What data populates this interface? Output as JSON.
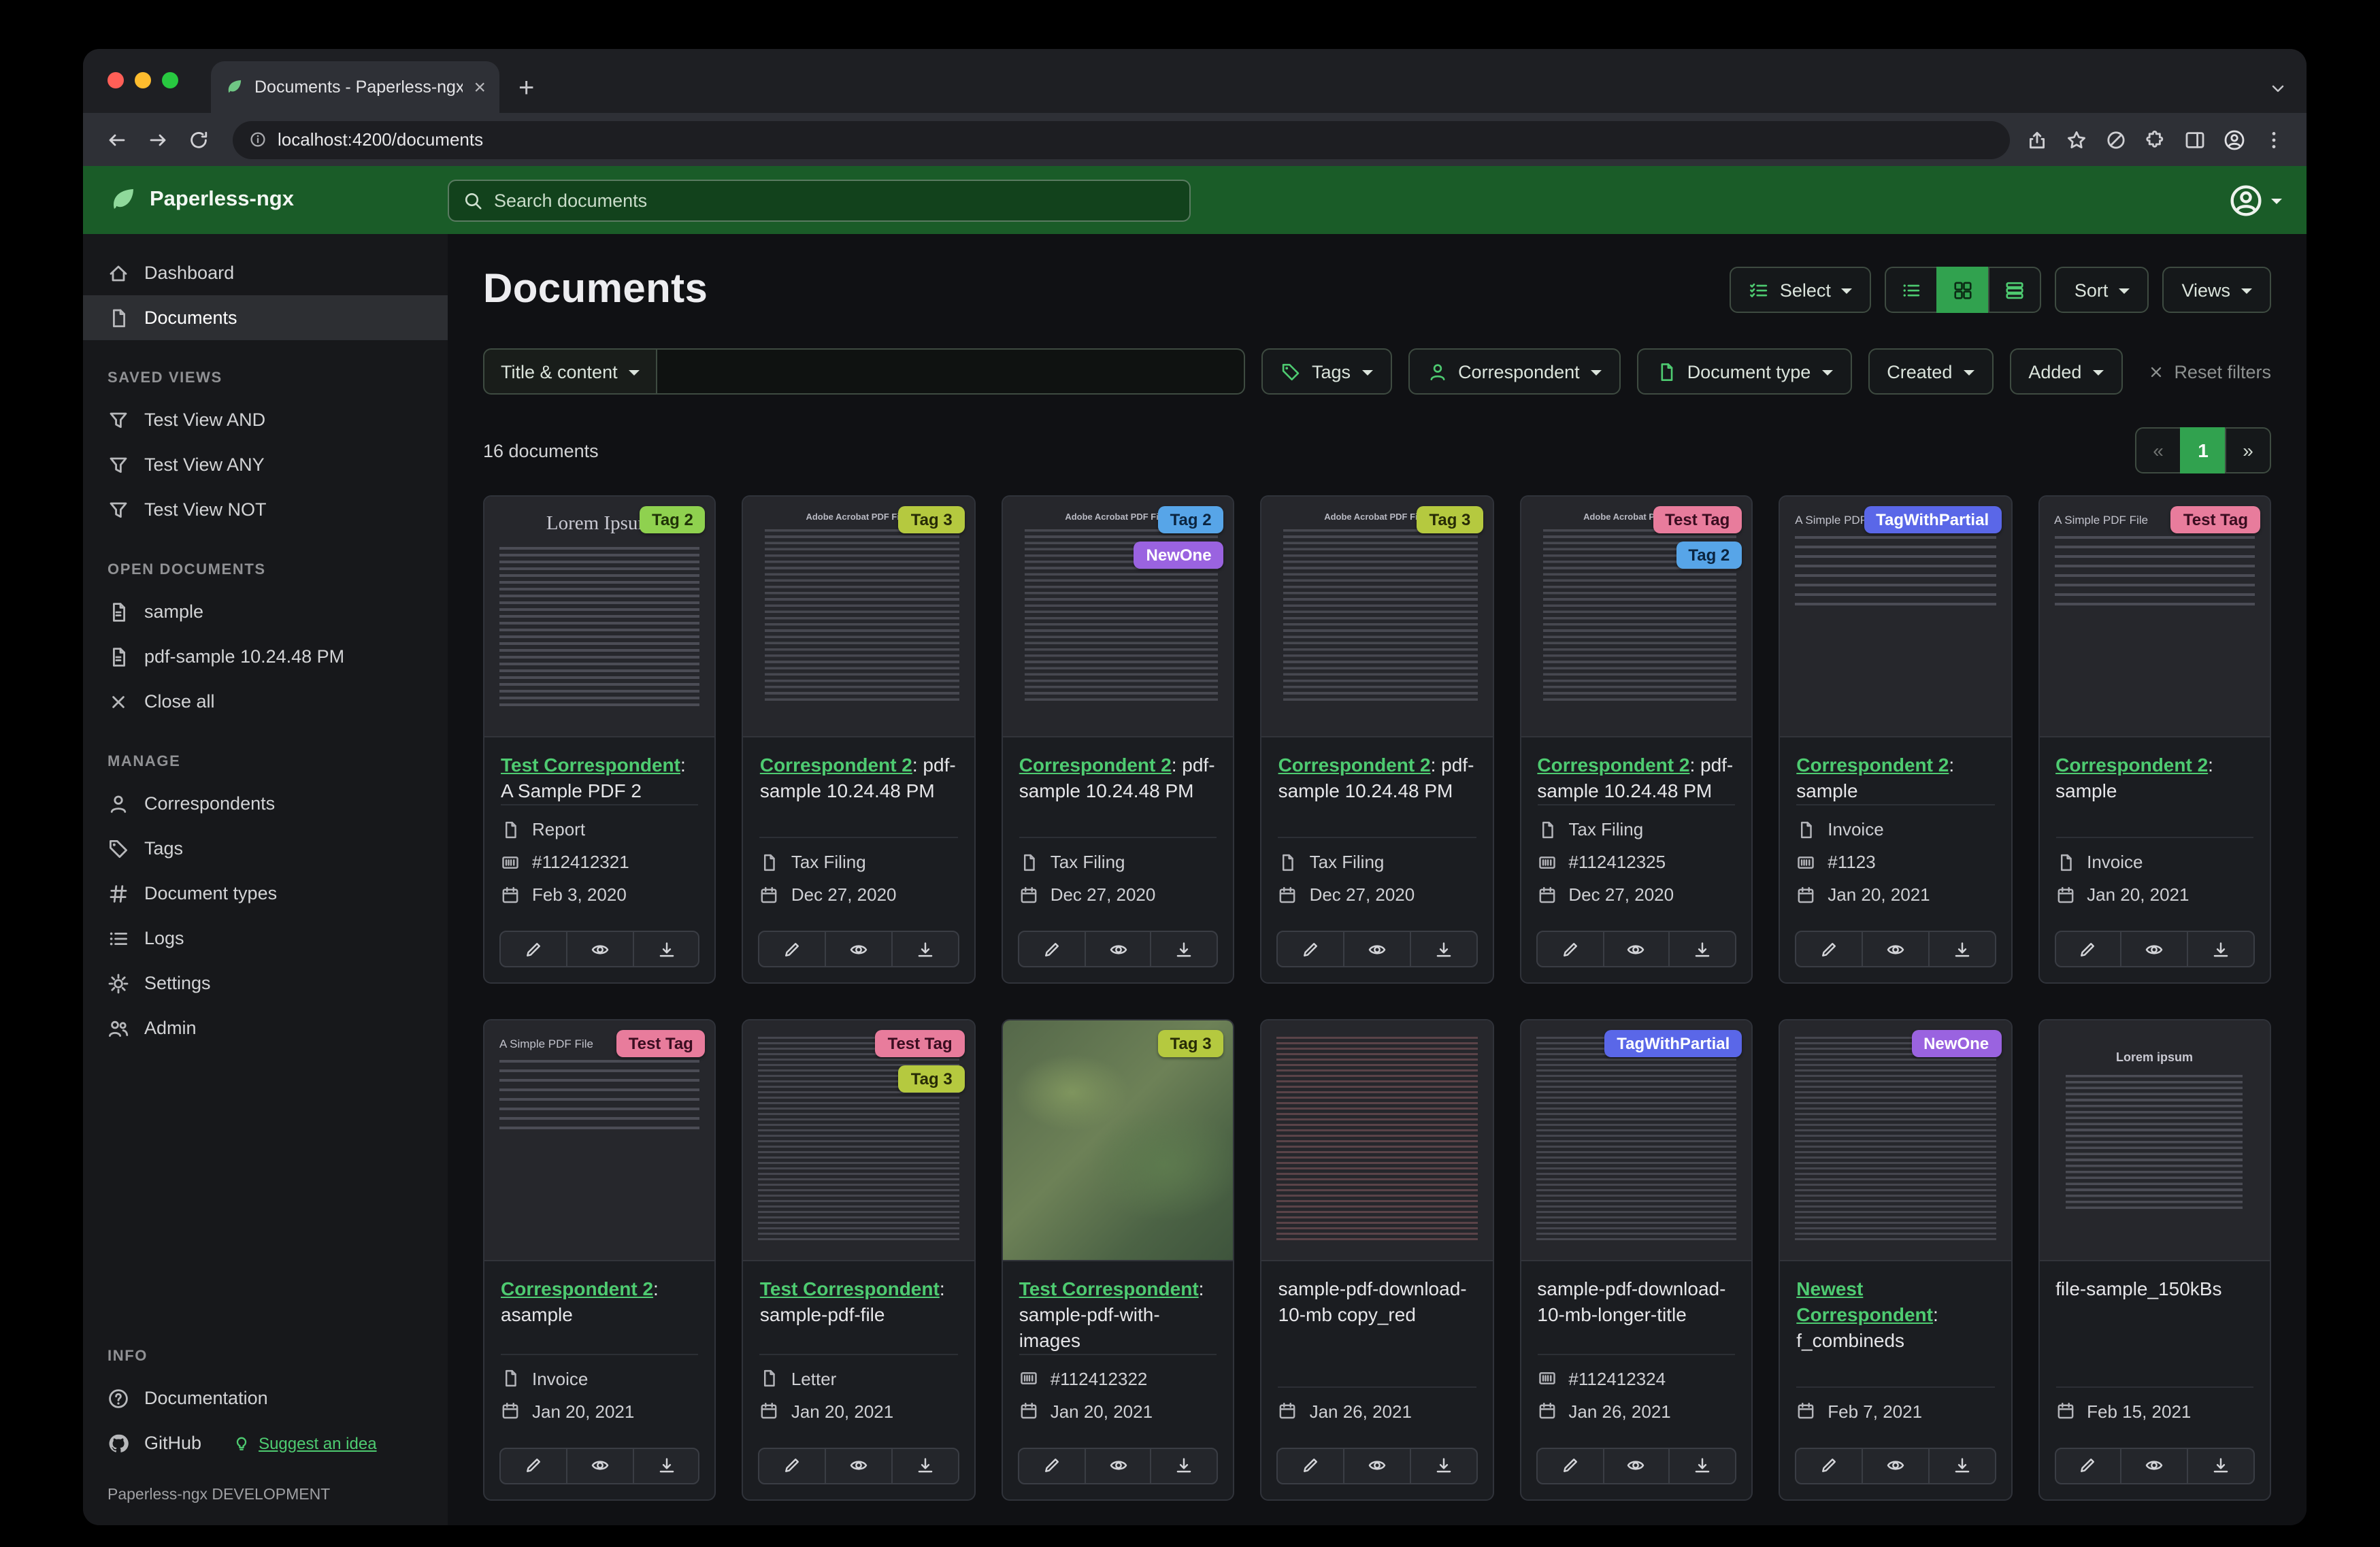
{
  "colors": {
    "header_green": "#1a5c28",
    "accent_green": "#4ecb71",
    "active_green": "#31a24f"
  },
  "browser": {
    "tab_title": "Documents - Paperless-ngx",
    "url": "localhost:4200/documents"
  },
  "header": {
    "brand": "Paperless-ngx",
    "search_placeholder": "Search documents"
  },
  "sidebar": {
    "primary": [
      {
        "label": "Dashboard",
        "icon": "home"
      },
      {
        "label": "Documents",
        "icon": "files",
        "active": true
      }
    ],
    "sections": [
      {
        "title": "SAVED VIEWS",
        "items": [
          {
            "label": "Test View AND",
            "icon": "funnel"
          },
          {
            "label": "Test View ANY",
            "icon": "funnel"
          },
          {
            "label": "Test View NOT",
            "icon": "funnel"
          }
        ]
      },
      {
        "title": "OPEN DOCUMENTS",
        "items": [
          {
            "label": "sample",
            "icon": "filetext"
          },
          {
            "label": "pdf-sample 10.24.48 PM",
            "icon": "filetext"
          },
          {
            "label": "Close all",
            "icon": "x"
          }
        ]
      },
      {
        "title": "MANAGE",
        "items": [
          {
            "label": "Correspondents",
            "icon": "person"
          },
          {
            "label": "Tags",
            "icon": "tag"
          },
          {
            "label": "Document types",
            "icon": "hash"
          },
          {
            "label": "Logs",
            "icon": "list"
          },
          {
            "label": "Settings",
            "icon": "gear"
          },
          {
            "label": "Admin",
            "icon": "people"
          }
        ]
      },
      {
        "title": "INFO",
        "items": [
          {
            "label": "Documentation",
            "icon": "question"
          },
          {
            "label": "GitHub",
            "icon": "github",
            "extra": "Suggest an idea"
          }
        ]
      }
    ],
    "footer": "Paperless-ngx DEVELOPMENT"
  },
  "page": {
    "title": "Documents",
    "select_label": "Select",
    "sort_label": "Sort",
    "views_label": "Views",
    "count_text": "16 documents",
    "pagination": {
      "prev": "«",
      "page": "1",
      "next": "»"
    }
  },
  "filters": {
    "field_button": "Title & content",
    "query_value": "",
    "tags_label": "Tags",
    "correspondent_label": "Correspondent",
    "doctype_label": "Document type",
    "created_label": "Created",
    "added_label": "Added",
    "reset_label": "Reset filters"
  },
  "cards": [
    {
      "tags": [
        {
          "label": "Tag 2",
          "bg": "#8fd14f",
          "fg": "#203307"
        }
      ],
      "title_link": "Test Correspondent",
      "title_rest": ": A Sample PDF 2",
      "meta": [
        {
          "icon": "file",
          "text": "Report"
        },
        {
          "icon": "asn",
          "text": "#112412321"
        },
        {
          "icon": "calendar",
          "text": "Feb 3, 2020"
        }
      ],
      "thumb": {
        "variant": "serif",
        "heading": "Lorem Ipsum"
      }
    },
    {
      "tags": [
        {
          "label": "Tag 3",
          "bg": "#b5c93f",
          "fg": "#272b06"
        }
      ],
      "title_link": "Correspondent 2",
      "title_rest": ": pdf-sample 10.24.48 PM",
      "meta": [
        {
          "icon": "file",
          "text": "Tax Filing"
        },
        {
          "icon": "calendar",
          "text": "Dec 27, 2020"
        }
      ],
      "thumb": {
        "variant": "acrobat",
        "heading": "Adobe Acrobat PDF Files"
      }
    },
    {
      "tags": [
        {
          "label": "Tag 2",
          "bg": "#57a5e8",
          "fg": "#0b2540"
        },
        {
          "label": "NewOne",
          "bg": "#9a63e0",
          "fg": "#ffffff"
        }
      ],
      "title_link": "Correspondent 2",
      "title_rest": ": pdf-sample 10.24.48 PM",
      "meta": [
        {
          "icon": "file",
          "text": "Tax Filing"
        },
        {
          "icon": "calendar",
          "text": "Dec 27, 2020"
        }
      ],
      "thumb": {
        "variant": "acrobat",
        "heading": "Adobe Acrobat PDF Files"
      }
    },
    {
      "tags": [
        {
          "label": "Tag 3",
          "bg": "#b5c93f",
          "fg": "#272b06"
        }
      ],
      "title_link": "Correspondent 2",
      "title_rest": ": pdf-sample 10.24.48 PM",
      "meta": [
        {
          "icon": "file",
          "text": "Tax Filing"
        },
        {
          "icon": "calendar",
          "text": "Dec 27, 2020"
        }
      ],
      "thumb": {
        "variant": "acrobat",
        "heading": "Adobe Acrobat PDF Files"
      }
    },
    {
      "tags": [
        {
          "label": "Test Tag",
          "bg": "#e87c9c",
          "fg": "#3a0d20"
        },
        {
          "label": "Tag 2",
          "bg": "#57a5e8",
          "fg": "#0b2540"
        }
      ],
      "title_link": "Correspondent 2",
      "title_rest": ": pdf-sample 10.24.48 PM",
      "meta": [
        {
          "icon": "file",
          "text": "Tax Filing"
        },
        {
          "icon": "asn",
          "text": "#112412325"
        },
        {
          "icon": "calendar",
          "text": "Dec 27, 2020"
        }
      ],
      "thumb": {
        "variant": "acrobat",
        "heading": "Adobe Acrobat PDF Files"
      }
    },
    {
      "tags": [
        {
          "label": "TagWithPartial",
          "bg": "#5a67e8",
          "fg": "#ffffff"
        }
      ],
      "title_link": "Correspondent 2",
      "title_rest": ": sample",
      "meta": [
        {
          "icon": "file",
          "text": "Invoice"
        },
        {
          "icon": "asn",
          "text": "#1123"
        },
        {
          "icon": "calendar",
          "text": "Jan 20, 2021"
        }
      ],
      "thumb": {
        "variant": "simple",
        "heading": "A Simple PDF File"
      }
    },
    {
      "tags": [
        {
          "label": "Test Tag",
          "bg": "#e87c9c",
          "fg": "#3a0d20"
        }
      ],
      "title_link": "Correspondent 2",
      "title_rest": ": sample",
      "meta": [
        {
          "icon": "file",
          "text": "Invoice"
        },
        {
          "icon": "calendar",
          "text": "Jan 20, 2021"
        }
      ],
      "thumb": {
        "variant": "simple",
        "heading": "A Simple PDF File"
      }
    },
    {
      "tags": [
        {
          "label": "Test Tag",
          "bg": "#e87c9c",
          "fg": "#3a0d20"
        }
      ],
      "title_link": "Correspondent 2",
      "title_rest": ": asample",
      "meta": [
        {
          "icon": "file",
          "text": "Invoice"
        },
        {
          "icon": "calendar",
          "text": "Jan 20, 2021"
        }
      ],
      "thumb": {
        "variant": "simple",
        "heading": "A Simple PDF File"
      }
    },
    {
      "tags": [
        {
          "label": "Test Tag",
          "bg": "#e87c9c",
          "fg": "#3a0d20"
        },
        {
          "label": "Tag 3",
          "bg": "#b5c93f",
          "fg": "#272b06"
        }
      ],
      "title_link": "Test Correspondent",
      "title_rest": ": sample-pdf-file",
      "meta": [
        {
          "icon": "file",
          "text": "Letter"
        },
        {
          "icon": "calendar",
          "text": "Jan 20, 2021"
        }
      ],
      "thumb": {
        "variant": "dense",
        "heading": ""
      }
    },
    {
      "tags": [
        {
          "label": "Tag 3",
          "bg": "#b5c93f",
          "fg": "#272b06"
        }
      ],
      "title_link": "Test Correspondent",
      "title_rest": ": sample-pdf-with-images",
      "meta": [
        {
          "icon": "asn",
          "text": "#112412322"
        },
        {
          "icon": "calendar",
          "text": "Jan 20, 2021"
        }
      ],
      "thumb": {
        "variant": "map",
        "heading": ""
      }
    },
    {
      "tags": [],
      "title_link": null,
      "title_rest": "sample-pdf-download-10-mb copy_red",
      "meta": [
        {
          "icon": "calendar",
          "text": "Jan 26, 2021"
        }
      ],
      "thumb": {
        "variant": "red",
        "heading": ""
      }
    },
    {
      "tags": [
        {
          "label": "TagWithPartial",
          "bg": "#5a67e8",
          "fg": "#ffffff"
        }
      ],
      "title_link": null,
      "title_rest": "sample-pdf-download-10-mb-longer-title",
      "meta": [
        {
          "icon": "asn",
          "text": "#112412324"
        },
        {
          "icon": "calendar",
          "text": "Jan 26, 2021"
        }
      ],
      "thumb": {
        "variant": "dense",
        "heading": ""
      }
    },
    {
      "tags": [
        {
          "label": "NewOne",
          "bg": "#9a63e0",
          "fg": "#ffffff"
        }
      ],
      "title_link": "Newest Correspondent",
      "title_rest": ": f_combineds",
      "meta": [
        {
          "icon": "calendar",
          "text": "Feb 7, 2021"
        }
      ],
      "thumb": {
        "variant": "dense",
        "heading": ""
      }
    },
    {
      "tags": [],
      "title_link": null,
      "title_rest": "file-sample_150kBs",
      "meta": [
        {
          "icon": "calendar",
          "text": "Feb 15, 2021"
        }
      ],
      "thumb": {
        "variant": "center",
        "heading": "Lorem ipsum"
      }
    }
  ]
}
